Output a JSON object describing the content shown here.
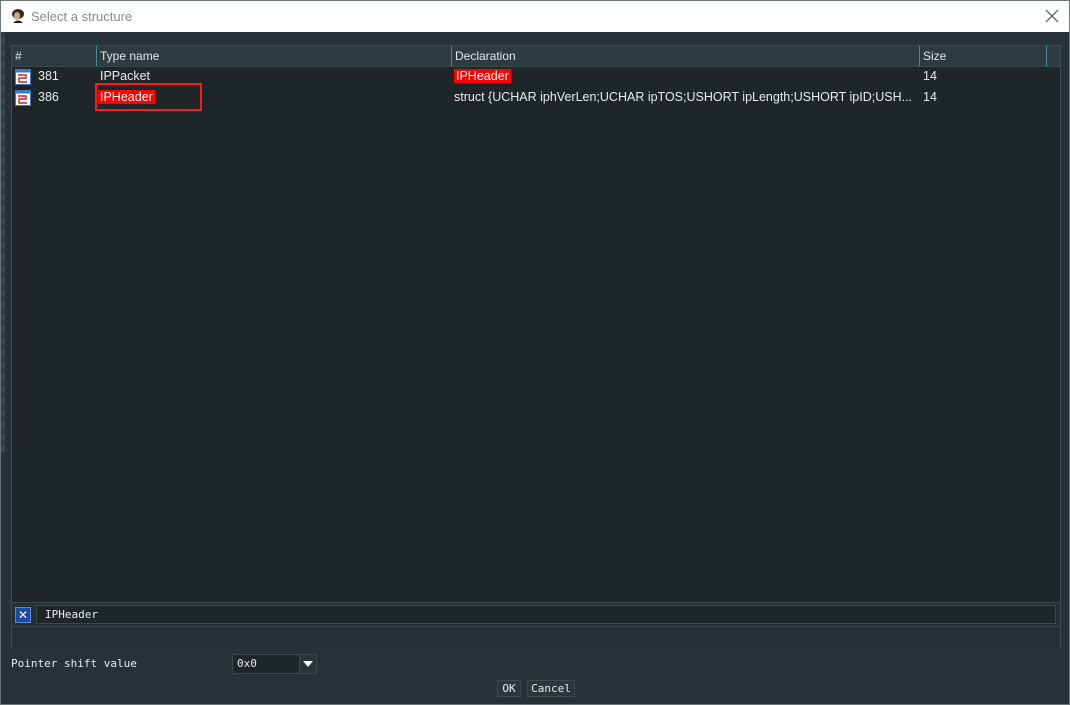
{
  "window": {
    "title": "Select a structure"
  },
  "table": {
    "columns": [
      "#",
      "Type name",
      "Declaration",
      "Size"
    ],
    "rows": [
      {
        "num": "381",
        "type_name": "IPPacket",
        "declaration": "IPHeader",
        "size": "14"
      },
      {
        "num": "386",
        "type_name": "IPHeader",
        "declaration": "struct {UCHAR iphVerLen;UCHAR ipTOS;USHORT ipLength;USHORT ipID;USH...",
        "size": "14"
      }
    ]
  },
  "filter": {
    "value": "IPHeader"
  },
  "pointer": {
    "label": "Pointer shift value",
    "value": "0x0"
  },
  "buttons": {
    "ok": "OK",
    "cancel": "Cancel"
  },
  "colors": {
    "highlight": "#ff0000",
    "background": "#263236",
    "header_border": "#3f8f96"
  },
  "icons": {
    "app": "app-icon",
    "close": "close-icon",
    "struct": "struct-icon",
    "clear": "clear-filter-icon",
    "dropdown": "chevron-down-icon"
  }
}
